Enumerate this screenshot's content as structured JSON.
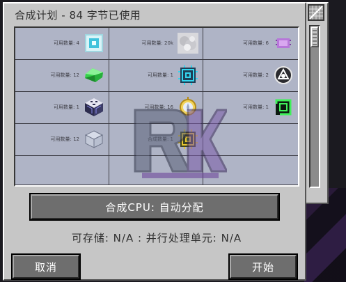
{
  "title": "合成计划 - 84 字节已使用",
  "grid": {
    "cells": [
      {
        "label": "可用数量: 4",
        "icon": "cyan-glass-block-icon"
      },
      {
        "label": "可用数量: 20k",
        "icon": "smoke-cloud-icon"
      },
      {
        "label": "可用数量: 6",
        "icon": "purple-circuit-chip-icon"
      },
      {
        "label": "可用数量: 12",
        "icon": "green-emerald-crystal-icon"
      },
      {
        "label": "可用数量: 1",
        "icon": "cyan-processor-icon"
      },
      {
        "label": "可用数量: 2",
        "icon": "arc-reactor-icon"
      },
      {
        "label": "可用数量: 1",
        "icon": "storage-cube-icon"
      },
      {
        "label": "可用数量: 16",
        "icon": "gold-gear-pendant-icon"
      },
      {
        "label": "可用数量: 1",
        "icon": "green-frame-icon"
      },
      {
        "label": "可用数量: 12",
        "icon": "glass-cube-icon"
      },
      {
        "label": "合成数量: 1",
        "icon": "gold-processor-icon"
      },
      {
        "label": "",
        "icon": ""
      },
      {
        "label": "",
        "icon": ""
      },
      {
        "label": "",
        "icon": ""
      },
      {
        "label": "",
        "icon": ""
      }
    ]
  },
  "cpu_button": "合成CPU: 自动分配",
  "info_line": "可存储: N/A : 并行处理单元: N/A",
  "cancel_button": "取消",
  "start_button": "开始",
  "scroll": {
    "position": 0
  }
}
